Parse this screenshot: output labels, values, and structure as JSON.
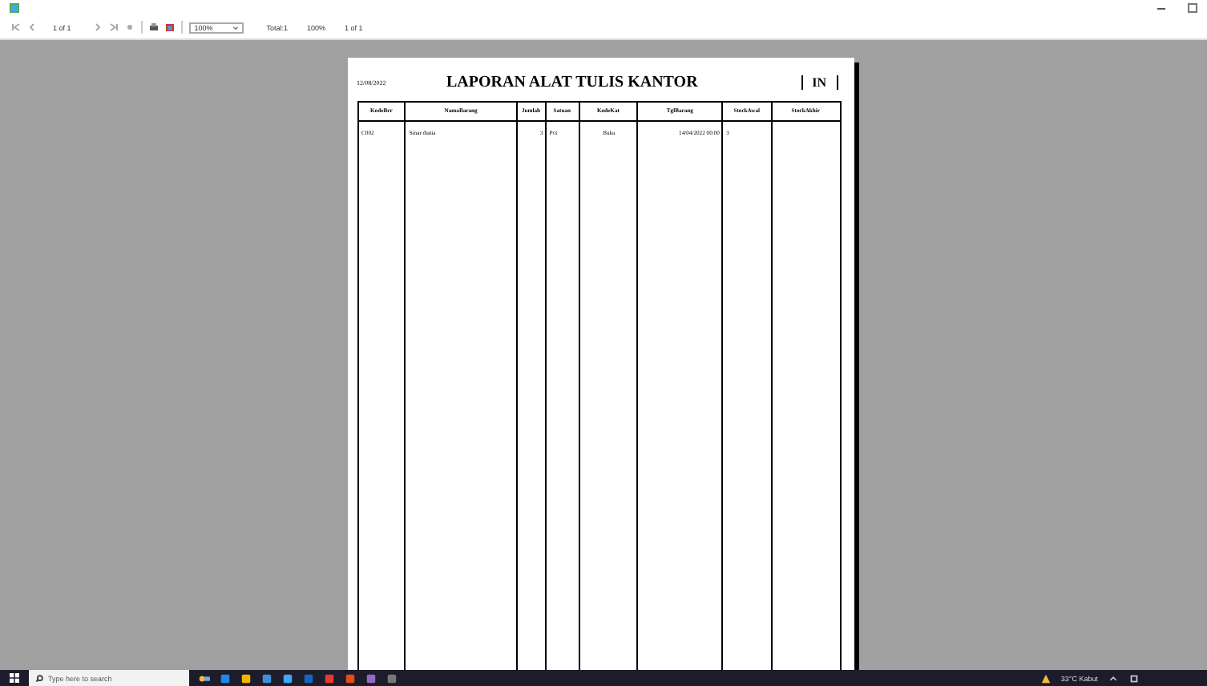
{
  "toolbar": {
    "page_field": "1 of 1",
    "zoom": "100%",
    "total": "Total:1",
    "zoom_percent": "100%",
    "page_count": "1 of 1"
  },
  "report": {
    "date": "12/08/2022",
    "title": "LAPORAN ALAT TULIS KANTOR",
    "badge": "IN",
    "columns": [
      "KodeBrr",
      "NamaBarang",
      "Jumlah",
      "Satuan",
      "KodeKat",
      "TglBarang",
      "StockAwal",
      "StockAkhir"
    ],
    "rows": [
      [
        "C002",
        "Sinar dunia",
        "3",
        "Pcs",
        "Buku",
        "14/04/2022 00:00",
        "3",
        ""
      ]
    ]
  },
  "taskbar": {
    "search_placeholder": "Type here to search",
    "weather": "33°C Kabut"
  }
}
